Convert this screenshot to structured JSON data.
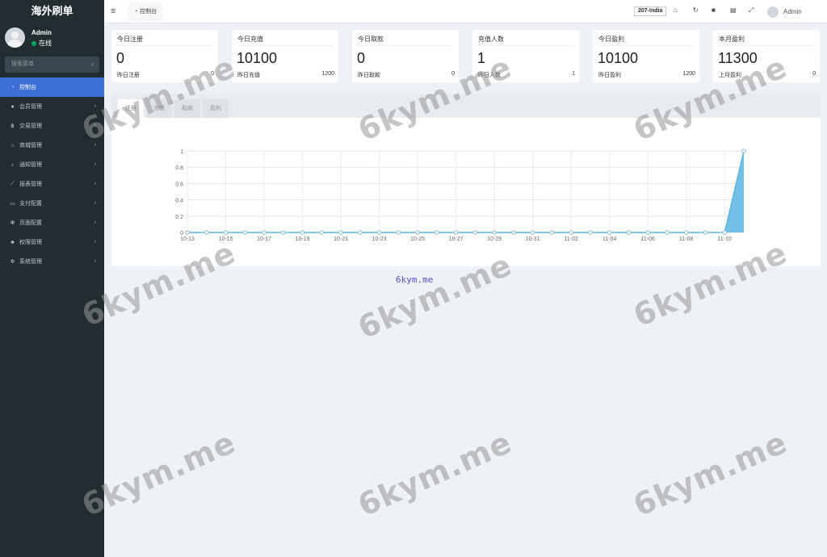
{
  "brand": "海外刷单",
  "user": {
    "name": "Admin",
    "status": "在线"
  },
  "search": {
    "placeholder": "搜索菜单"
  },
  "menu": [
    {
      "label": "控制台",
      "icon": "dashboard-icon",
      "glyph": "◔",
      "active": true
    },
    {
      "label": "会员管理",
      "icon": "user-circle-icon",
      "glyph": "●"
    },
    {
      "label": "交易管理",
      "icon": "bitcoin-icon",
      "glyph": "฿"
    },
    {
      "label": "商城管理",
      "icon": "home-icon",
      "glyph": "⌂"
    },
    {
      "label": "通知管理",
      "icon": "bell-icon",
      "glyph": "♪"
    },
    {
      "label": "报表管理",
      "icon": "line-chart-icon",
      "glyph": "⟋"
    },
    {
      "label": "支付配置",
      "icon": "credit-card-icon",
      "glyph": "▭"
    },
    {
      "label": "页面配置",
      "icon": "gear-icon",
      "glyph": "✻"
    },
    {
      "label": "权限管理",
      "icon": "users-icon",
      "glyph": "♣"
    },
    {
      "label": "系统管理",
      "icon": "cogs-icon",
      "glyph": "✲"
    }
  ],
  "topbar": {
    "tab_label": "控制台",
    "server": "207-India",
    "user": "Admin"
  },
  "cards": [
    {
      "title": "今日注册",
      "value": "0",
      "sub_label": "昨日注册",
      "sub_value": "0"
    },
    {
      "title": "今日充值",
      "value": "10100",
      "sub_label": "昨日充值",
      "sub_value": "1200"
    },
    {
      "title": "今日取款",
      "value": "0",
      "sub_label": "昨日取款",
      "sub_value": "0"
    },
    {
      "title": "充值人数",
      "value": "1",
      "sub_label": "昨日人数",
      "sub_value": "1"
    },
    {
      "title": "今日盈利",
      "value": "10100",
      "sub_label": "昨日盈利",
      "sub_value": "1200"
    },
    {
      "title": "本月盈利",
      "value": "11300",
      "sub_label": "上月盈利",
      "sub_value": "0"
    }
  ],
  "chart_tabs": [
    "注册",
    "充值",
    "取款",
    "盈利"
  ],
  "chart_data": {
    "type": "area",
    "x": [
      "10-13",
      "10-14",
      "10-15",
      "10-16",
      "10-17",
      "10-18",
      "10-19",
      "10-20",
      "10-21",
      "10-22",
      "10-23",
      "10-24",
      "10-25",
      "10-26",
      "10-27",
      "10-28",
      "10-29",
      "10-30",
      "10-31",
      "11-01",
      "11-02",
      "11-03",
      "11-04",
      "11-05",
      "11-06",
      "11-07",
      "11-08",
      "11-09",
      "11-10",
      "11-11"
    ],
    "x_tick_labels": [
      "10-13",
      "10-15",
      "10-17",
      "10-19",
      "10-21",
      "10-23",
      "10-25",
      "10-27",
      "10-29",
      "10-31",
      "11-02",
      "11-04",
      "11-06",
      "11-08",
      "11-10"
    ],
    "values": [
      0,
      0,
      0,
      0,
      0,
      0,
      0,
      0,
      0,
      0,
      0,
      0,
      0,
      0,
      0,
      0,
      0,
      0,
      0,
      0,
      0,
      0,
      0,
      0,
      0,
      0,
      0,
      0,
      0,
      1
    ],
    "y_ticks": [
      "0",
      "0.2",
      "0.4",
      "0.6",
      "0.8",
      "1"
    ],
    "ylim": [
      0,
      1
    ],
    "grid": true,
    "color": "#5bb5e0"
  },
  "watermark": "6kym.me",
  "watermark_caption": "6kym.me"
}
